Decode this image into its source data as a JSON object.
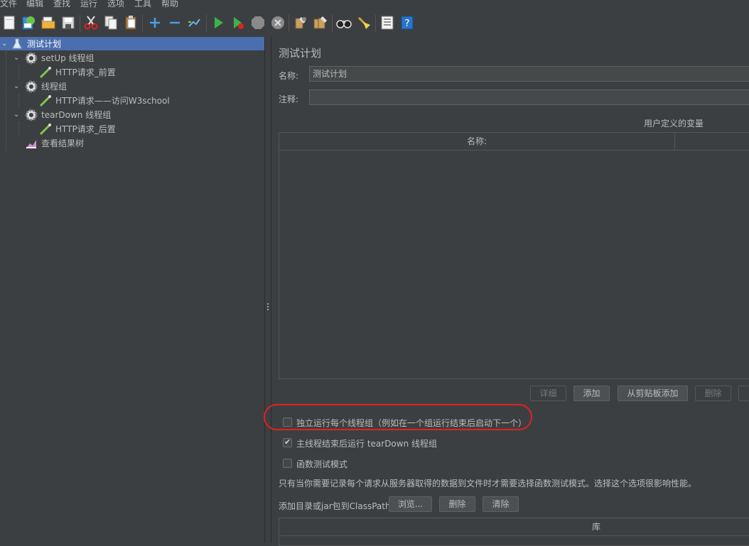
{
  "menu": [
    "文件",
    "编辑",
    "查找",
    "运行",
    "选项",
    "工具",
    "帮助"
  ],
  "toolbar_icons": [
    "new-icon",
    "templates-icon",
    "open-icon",
    "save-icon",
    "cut-icon",
    "copy-icon",
    "paste-icon",
    "expand-icon",
    "collapse-icon",
    "toggle-icon",
    "start-icon",
    "start-no-pause-icon",
    "stop-icon",
    "shutdown-icon",
    "clear-icon",
    "clear-all-icon",
    "search-icon",
    "reset-search-icon",
    "function-helper-icon",
    "help-icon"
  ],
  "tree": {
    "items": [
      {
        "label": "测试计划",
        "icon": "test-plan-icon",
        "selected": true
      },
      {
        "label": "setUp 线程组",
        "icon": "gear-icon"
      },
      {
        "label": "HTTP请求_前置",
        "icon": "http-sampler-icon"
      },
      {
        "label": "线程组",
        "icon": "gear-icon"
      },
      {
        "label": "HTTP请求——访问W3school",
        "icon": "http-sampler-icon"
      },
      {
        "label": "tearDown 线程组",
        "icon": "gear-icon"
      },
      {
        "label": "HTTP请求_后置",
        "icon": "http-sampler-icon"
      },
      {
        "label": "查看结果树",
        "icon": "result-tree-icon"
      }
    ]
  },
  "panel": {
    "title": "测试计划",
    "name_label": "名称:",
    "name_value": "测试计划",
    "comment_label": "注释:",
    "comment_value": "",
    "vars_caption": "用户定义的变量",
    "vars_col_name": "名称:",
    "buttons": {
      "detail": "详细",
      "add": "添加",
      "add_clipboard": "从剪贴板添加",
      "delete": "删除"
    },
    "checkbox1": {
      "label": "独立运行每个线程组（例如在一个组运行结束后启动下一个）",
      "checked": false
    },
    "checkbox2": {
      "label": "主线程结束后运行 tearDown 线程组",
      "checked": true
    },
    "checkbox3": {
      "label": "函数测试模式",
      "checked": false
    },
    "note": "只有当你需要记录每个请求从服务器取得的数据到文件时才需要选择函数测试模式。选择这个选项很影响性能。",
    "classpath_label": "添加目录或jar包到ClassPath",
    "classpath_buttons": {
      "browse": "浏览...",
      "delete": "删除",
      "clear": "清除"
    },
    "lib_col": "库"
  }
}
